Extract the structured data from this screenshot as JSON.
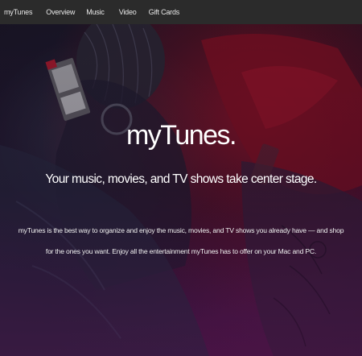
{
  "nav": {
    "brand": "myTunes",
    "items": [
      "Overview",
      "Music",
      "Video",
      "Gift Cards"
    ]
  },
  "hero": {
    "title": "myTunes.",
    "subtitle": "Your music, movies, and TV shows take center stage.",
    "body": "myTunes is the best way to organize and enjoy the music, movies, and TV shows you already have — and shop for the ones you want. Enjoy all the entertainment myTunes has to offer on your Mac and PC."
  },
  "colors": {
    "nav_background": "#2b2b2b",
    "accent_red": "#a8142a",
    "accent_purple": "#4a1846"
  }
}
